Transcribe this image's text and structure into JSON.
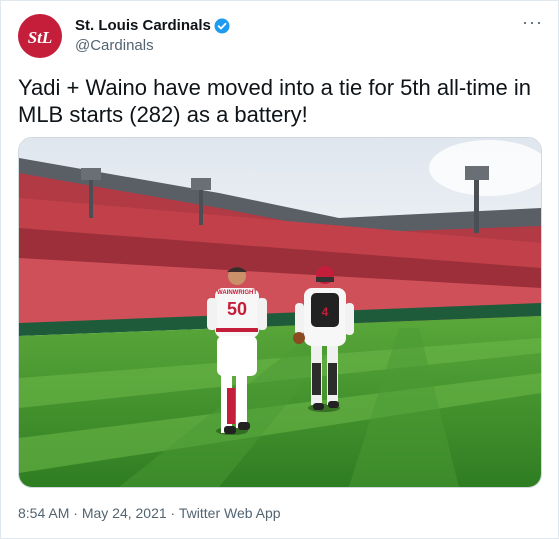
{
  "tweet": {
    "display_name": "St. Louis Cardinals",
    "handle": "@Cardinals",
    "avatar_text": "StL",
    "text": "Yadi + Waino have moved into a tie for 5th all-time in MLB starts (282) as a battery!",
    "time": "8:54 AM",
    "date": "May 24, 2021",
    "source": "Twitter Web App",
    "separator": " · ",
    "more_label": "···"
  },
  "photo": {
    "pitcher_name": "WAINWRIGHT",
    "pitcher_number": "50",
    "catcher_number": "4"
  },
  "colors": {
    "brand_red": "#c41e3a",
    "verified_blue": "#1d9bf0",
    "grass": "#3e8f2c"
  }
}
